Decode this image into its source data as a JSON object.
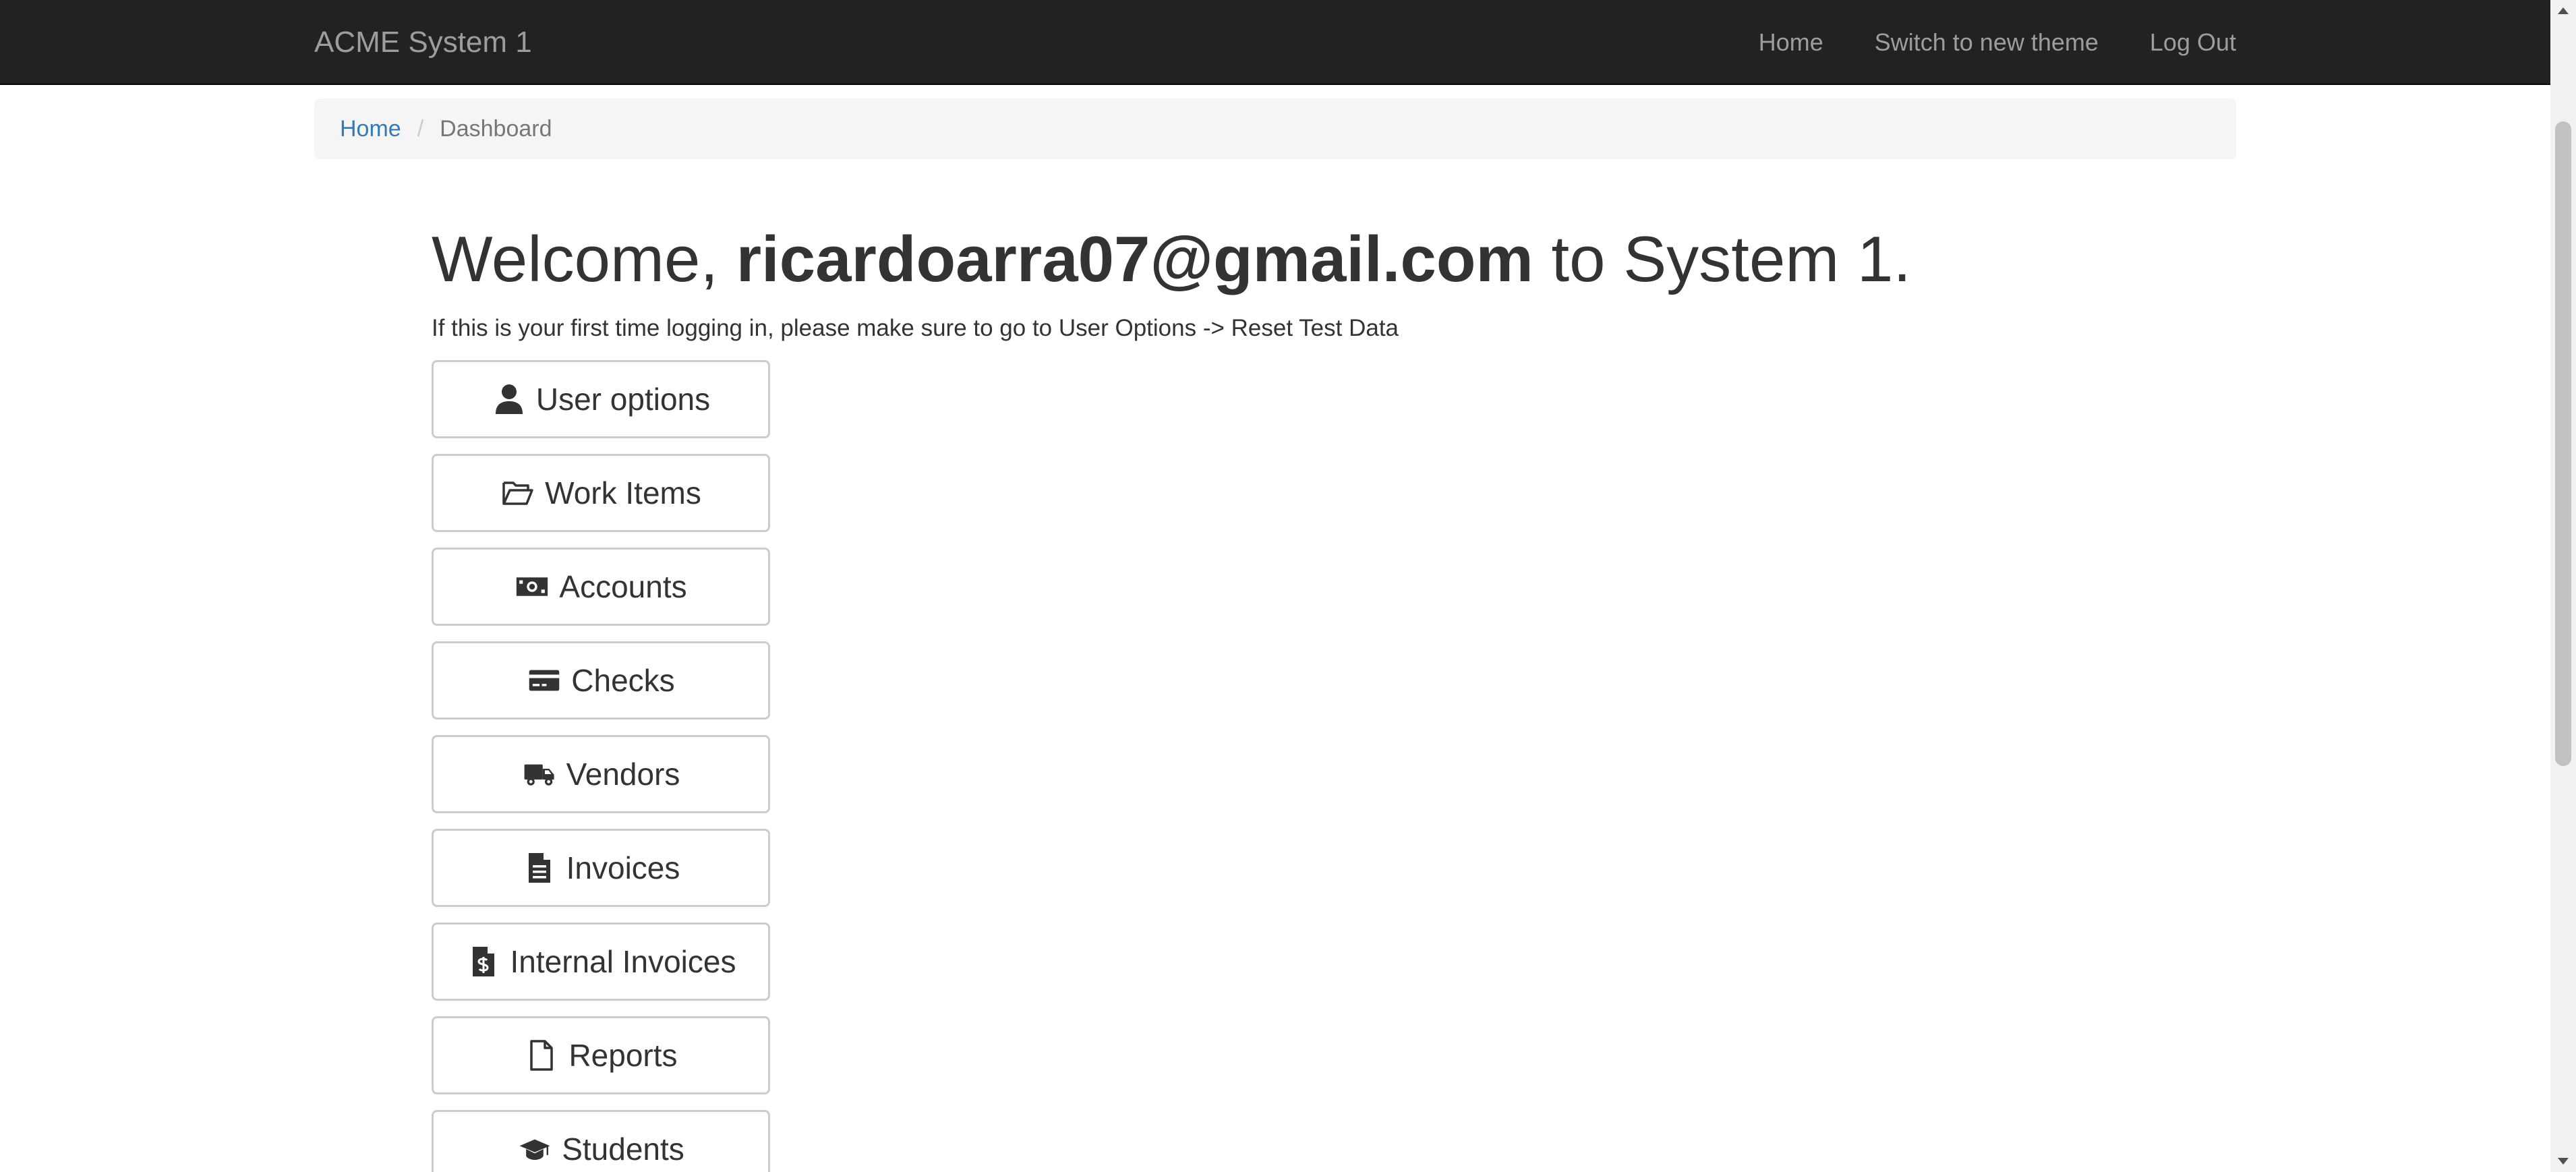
{
  "navbar": {
    "brand": "ACME System 1",
    "links": [
      "Home",
      "Switch to new theme",
      "Log Out"
    ]
  },
  "breadcrumb": {
    "home": "Home",
    "separator": "/",
    "current": "Dashboard"
  },
  "welcome": {
    "prefix": "Welcome, ",
    "email": "ricardoarra07@gmail.com",
    "suffix": " to System 1."
  },
  "intro": "If this is your first time logging in, please make sure to go to User Options -> Reset Test Data",
  "menu": [
    {
      "label": "User options",
      "icon": "user-icon"
    },
    {
      "label": "Work Items",
      "icon": "folder-open-icon"
    },
    {
      "label": "Accounts",
      "icon": "money-bill-icon"
    },
    {
      "label": "Checks",
      "icon": "credit-card-icon"
    },
    {
      "label": "Vendors",
      "icon": "truck-icon"
    },
    {
      "label": "Invoices",
      "icon": "file-text-icon"
    },
    {
      "label": "Internal Invoices",
      "icon": "file-invoice-dollar-icon"
    },
    {
      "label": "Reports",
      "icon": "file-icon"
    },
    {
      "label": "Students",
      "icon": "graduation-cap-icon"
    }
  ],
  "colors": {
    "navbar_bg": "#222222",
    "navbar_text": "#9d9d9d",
    "link": "#337ab7",
    "breadcrumb_bg": "#f5f5f5"
  }
}
